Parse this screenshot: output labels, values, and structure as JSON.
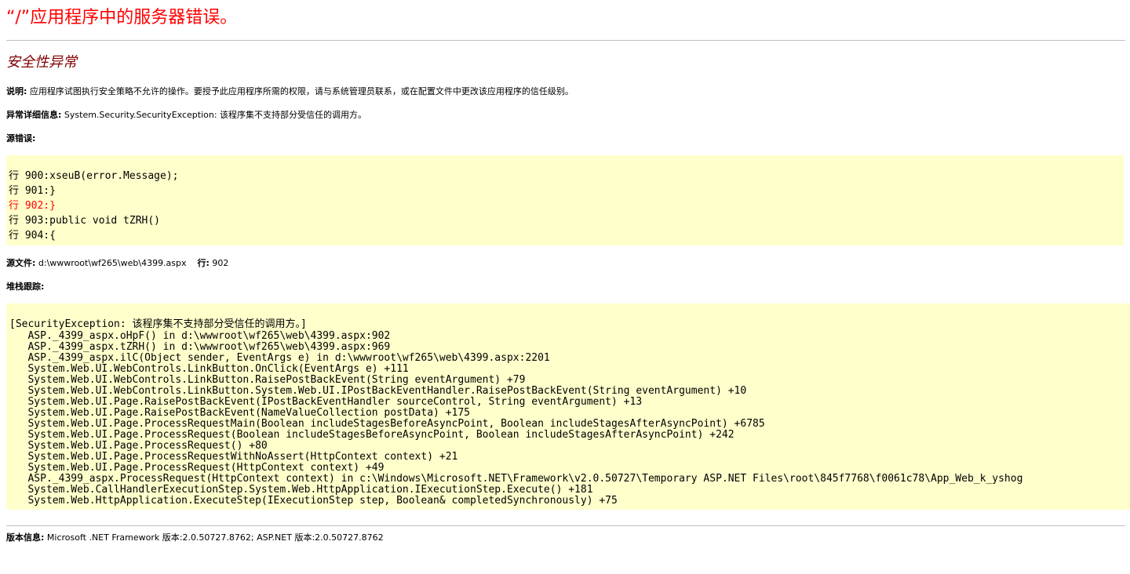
{
  "title": "“/”应用程序中的服务器错误。",
  "subtitle": "安全性异常",
  "description": {
    "label": "说明:",
    "text": " 应用程序试图执行安全策略不允许的操作。要授予此应用程序所需的权限，请与系统管理员联系，或在配置文件中更改该应用程序的信任级别。"
  },
  "exception_details": {
    "label": "异常详细信息:",
    "text": " System.Security.SecurityException: 该程序集不支持部分受信任的调用方。"
  },
  "source_error": {
    "label": "源错误:",
    "lines": [
      "行 900:xseuB(error.Message);",
      "行 901:}",
      "行 902:}",
      "行 903:public void tZRH()",
      "行 904:{"
    ],
    "highlight_line": 902
  },
  "source_file": {
    "label": "源文件:",
    "path": " d:\\wwwroot\\wf265\\web\\4399.aspx",
    "line_label": "行:",
    "line_value": " 902"
  },
  "stack_trace": {
    "label": "堆栈跟踪:",
    "lines": [
      "[SecurityException: 该程序集不支持部分受信任的调用方。]",
      "   ASP._4399_aspx.oHpF() in d:\\wwwroot\\wf265\\web\\4399.aspx:902",
      "   ASP._4399_aspx.tZRH() in d:\\wwwroot\\wf265\\web\\4399.aspx:969",
      "   ASP._4399_aspx.ilC(Object sender, EventArgs e) in d:\\wwwroot\\wf265\\web\\4399.aspx:2201",
      "   System.Web.UI.WebControls.LinkButton.OnClick(EventArgs e) +111",
      "   System.Web.UI.WebControls.LinkButton.RaisePostBackEvent(String eventArgument) +79",
      "   System.Web.UI.WebControls.LinkButton.System.Web.UI.IPostBackEventHandler.RaisePostBackEvent(String eventArgument) +10",
      "   System.Web.UI.Page.RaisePostBackEvent(IPostBackEventHandler sourceControl, String eventArgument) +13",
      "   System.Web.UI.Page.RaisePostBackEvent(NameValueCollection postData) +175",
      "   System.Web.UI.Page.ProcessRequestMain(Boolean includeStagesBeforeAsyncPoint, Boolean includeStagesAfterAsyncPoint) +6785",
      "   System.Web.UI.Page.ProcessRequest(Boolean includeStagesBeforeAsyncPoint, Boolean includeStagesAfterAsyncPoint) +242",
      "   System.Web.UI.Page.ProcessRequest() +80",
      "   System.Web.UI.Page.ProcessRequestWithNoAssert(HttpContext context) +21",
      "   System.Web.UI.Page.ProcessRequest(HttpContext context) +49",
      "   ASP._4399_aspx.ProcessRequest(HttpContext context) in c:\\Windows\\Microsoft.NET\\Framework\\v2.0.50727\\Temporary ASP.NET Files\\root\\845f7768\\f0061c78\\App_Web_k_yshog",
      "   System.Web.CallHandlerExecutionStep.System.Web.HttpApplication.IExecutionStep.Execute() +181",
      "   System.Web.HttpApplication.ExecuteStep(IExecutionStep step, Boolean& completedSynchronously) +75"
    ]
  },
  "version_info": {
    "label": "版本信息:",
    "text": " Microsoft .NET Framework 版本:2.0.50727.8762; ASP.NET 版本:2.0.50727.8762"
  },
  "colors": {
    "title": "#ff0000",
    "subtitle": "#800000",
    "code_background": "#ffffcc",
    "highlight_line": "#ff0000",
    "rule": "#c0c0c0"
  }
}
